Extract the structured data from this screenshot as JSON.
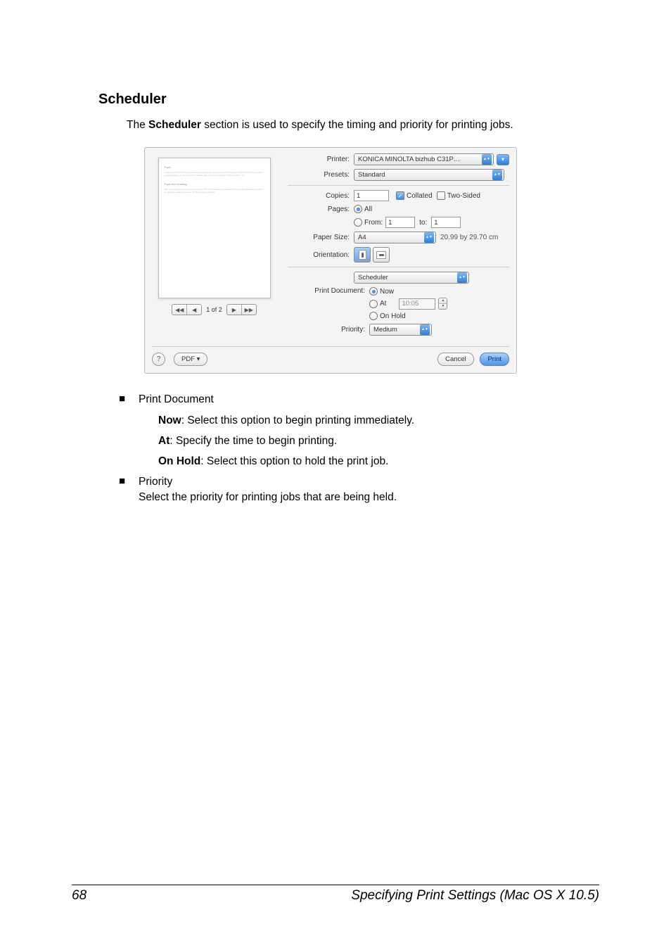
{
  "heading": "Scheduler",
  "intro_prefix": "The ",
  "intro_bold": "Scheduler",
  "intro_suffix": " section is used to specify the timing and priority for printing jobs.",
  "dialog": {
    "printer_label": "Printer:",
    "printer_value": "KONICA MINOLTA bizhub C31P…",
    "presets_label": "Presets:",
    "presets_value": "Standard",
    "copies_label": "Copies:",
    "copies_value": "1",
    "collated_label": "Collated",
    "twosided_label": "Two-Sided",
    "pages_label": "Pages:",
    "pages_all": "All",
    "pages_from": "From:",
    "pages_from_value": "1",
    "pages_to": "to:",
    "pages_to_value": "1",
    "paper_size_label": "Paper Size:",
    "paper_size_value": "A4",
    "paper_size_dims": "20.99 by 29.70 cm",
    "orientation_label": "Orientation:",
    "section_value": "Scheduler",
    "print_doc_label": "Print Document:",
    "print_doc_now": "Now",
    "print_doc_at": "At",
    "print_doc_at_time": "10:05",
    "print_doc_hold": "On Hold",
    "priority_label": "Priority:",
    "priority_value": "Medium",
    "preview_pages": "1 of 2",
    "pdf_button": "PDF ▾",
    "cancel_button": "Cancel",
    "print_button": "Print",
    "help_glyph": "?",
    "nav_first": "◀◀",
    "nav_prev": "◀",
    "nav_next": "▶",
    "nav_last": "▶▶"
  },
  "items": {
    "print_document_title": "Print Document",
    "now_bold": "Now",
    "now_text": ": Select this option to begin printing immediately.",
    "at_bold": "At",
    "at_text": ": Specify the time to begin printing.",
    "hold_bold": "On Hold",
    "hold_text": ": Select this option to hold the print job.",
    "priority_title": "Priority",
    "priority_text": "Select the priority for printing jobs that are being held."
  },
  "footer": {
    "page_number": "68",
    "title": "Specifying Print Settings (Mac OS X 10.5)"
  }
}
